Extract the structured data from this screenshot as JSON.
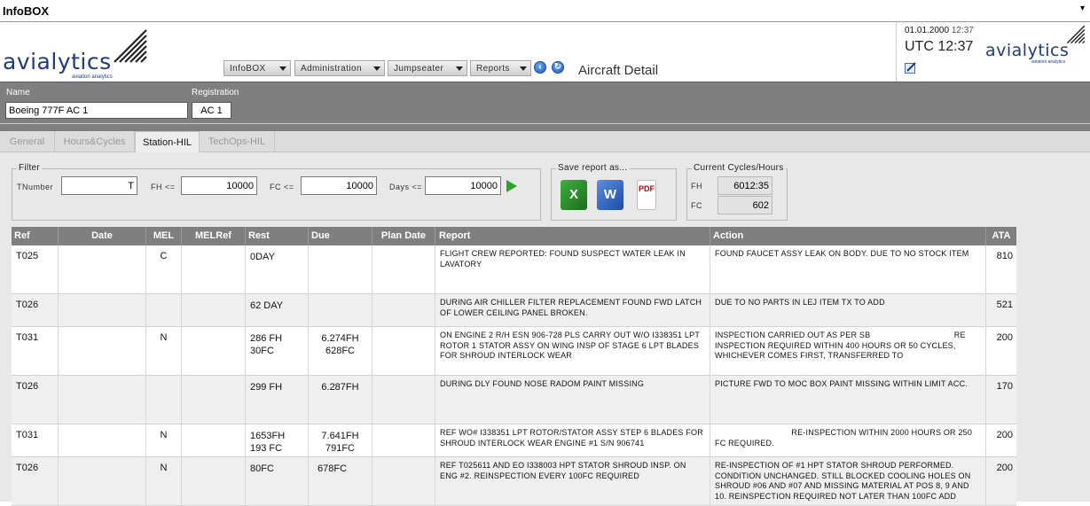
{
  "app": {
    "title": "InfoBOX",
    "menu_arrow": "▾"
  },
  "logo": {
    "wordmark": "avialytics",
    "tagline": "aviation analytics"
  },
  "nav": {
    "items": [
      {
        "label": "InfoBOX"
      },
      {
        "label": "Administration"
      },
      {
        "label": "Jumpseater"
      },
      {
        "label": "Reports"
      }
    ],
    "back_icon": "arrow-left-icon",
    "refresh_icon": "refresh-icon"
  },
  "page_title": "Aircraft Detail",
  "info_panel": {
    "date": "01.01.2000",
    "time": "12:37",
    "utc": "UTC 12:37"
  },
  "record": {
    "name_label": "Name",
    "name_value": "Boeing 777F AC 1",
    "registration_label": "Registration",
    "registration_value": "AC 1"
  },
  "tabs": [
    {
      "label": "General",
      "active": false
    },
    {
      "label": "Hours&Cycles",
      "active": false
    },
    {
      "label": "Station-HIL",
      "active": true
    },
    {
      "label": "TechOps-HIL",
      "active": false
    }
  ],
  "filter": {
    "title": "Filter",
    "tnumber_label": "TNumber",
    "tnumber_value": "T",
    "fh_label": "FH <=",
    "fh_value": "10000",
    "fc_label": "FC <=",
    "fc_value": "10000",
    "days_label": "Days <=",
    "days_value": "10000"
  },
  "save_report": {
    "title": "Save report as...",
    "excel_glyph": "X",
    "word_glyph": "W",
    "pdf_glyph": "PDF"
  },
  "cycles": {
    "title": "Current Cycles/Hours",
    "fh_label": "FH",
    "fh_value": "6012:35",
    "fc_label": "FC",
    "fc_value": "602"
  },
  "table": {
    "columns": [
      "Ref",
      "Date",
      "MEL",
      "MELRef",
      "Rest",
      "Due",
      "Plan Date",
      "Report",
      "Action",
      "ATA"
    ],
    "rows": [
      {
        "ref": "T025",
        "date": "",
        "mel": "C",
        "melref": "",
        "rest": [
          "0DAY"
        ],
        "due": [],
        "plan": "",
        "report": "FLIGHT CREW REPORTED: FOUND SUSPECT WATER LEAK IN LAVATORY",
        "action": "FOUND FAUCET ASSY LEAK ON BODY. DUE TO NO STOCK ITEM",
        "ata": "810"
      },
      {
        "ref": "T026",
        "date": "",
        "mel": "",
        "melref": "",
        "rest": [
          "62 DAY"
        ],
        "due": [],
        "plan": "",
        "report": "DURING AIR CHILLER FILTER REPLACEMENT FOUND FWD LATCH OF LOWER CEILING PANEL BROKEN.",
        "action": "DUE TO NO PARTS IN LEJ ITEM TX TO ADD",
        "ata": "521"
      },
      {
        "ref": "T031",
        "date": "",
        "mel": "N",
        "melref": "",
        "rest": [
          "286 FH",
          "30FC"
        ],
        "due": [
          "6.274FH",
          "628FC"
        ],
        "plan": "",
        "report": "ON ENGINE 2 R/H ESN 906-728 PLS CARRY OUT W/O I338351 LPT ROTOR 1 STATOR ASSY ON WING INSP OF STAGE 6 LPT BLADES FOR SHROUD INTERLOCK WEAR",
        "action": "INSPECTION CARRIED OUT AS PER SB                                   RE INSPECTION REQUIRED WITHIN 400 HOURS OR 50 CYCLES, WHICHEVER COMES FIRST, TRANSFERRED TO",
        "ata": "200"
      },
      {
        "ref": "T026",
        "date": "",
        "mel": "",
        "melref": "",
        "rest": [
          "299 FH"
        ],
        "due": [
          "6.287FH"
        ],
        "plan": "",
        "report": "DURING DLY FOUND NOSE RADOM PAINT MISSING",
        "action": "PICTURE FWD TO MOC BOX PAINT MISSING WITHIN LIMIT ACC.",
        "ata": "170"
      },
      {
        "ref": "T031",
        "date": "",
        "mel": "N",
        "melref": "",
        "rest": [
          "1653FH",
          "193 FC"
        ],
        "due": [
          "7.641FH",
          "791FC"
        ],
        "plan": "",
        "report": "REF WO# I338351 LPT ROTOR/STATOR ASSY STEP 6 BLADES FOR SHROUD INTERLOCK WEAR ENGINE #1 S/N 906741",
        "action": "                                RE-INSPECTION WITHIN 2000 HOURS OR 250 FC REQUIRED.",
        "ata": "200"
      },
      {
        "ref": "T026",
        "date": "",
        "mel": "N",
        "melref": "",
        "rest": [
          "80FC"
        ],
        "due": [
          "678FC"
        ],
        "plan": "",
        "report": "REF T025611 AND EO I338003 HPT STATOR SHROUD INSP. ON ENG #2. REINSPECTION EVERY 100FC REQUIRED",
        "action": "RE-INSPECTION OF #1 HPT STATOR SHROUD PERFORMED. CONDITION UNCHANGED. STILL BLOCKED COOLING HOLES ON SHROUD #06 AND #07 AND MISSING MATERIAL AT POS 8, 9 AND 10. REINSPECTION REQUIRED NOT LATER THAN 100FC ADD",
        "ata": "200"
      }
    ]
  }
}
